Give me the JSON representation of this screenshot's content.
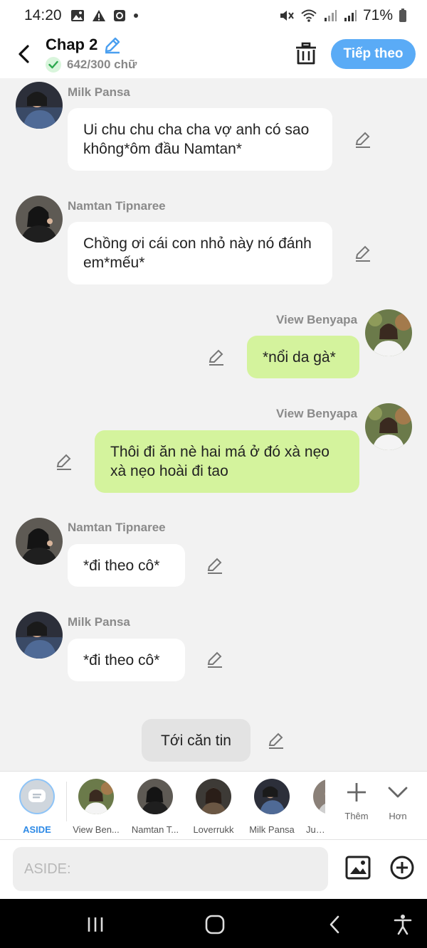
{
  "status_bar": {
    "time": "14:20",
    "battery": "71%"
  },
  "header": {
    "title": "Chap 2",
    "word_count": "642/300 chữ",
    "next_label": "Tiếp theo"
  },
  "messages": [
    {
      "sender": "Milk Pansa",
      "text": "Ui chu chu cha cha vợ anh có sao không*ôm đầu Namtan*",
      "side": "left"
    },
    {
      "sender": "Namtan Tipnaree",
      "text": "Chồng ơi cái con nhỏ này nó đánh em*mếu*",
      "side": "left"
    },
    {
      "sender": "View Benyapa",
      "text": "*nổi da gà*",
      "side": "right"
    },
    {
      "sender": "View Benyapa",
      "text": "Thôi đi ăn nè hai má ở đó xà nẹo xà nẹo hoài đi tao",
      "side": "right"
    },
    {
      "sender": "Namtan Tipnaree",
      "text": "*đi theo cô*",
      "side": "left"
    },
    {
      "sender": "Milk Pansa",
      "text": "*đi theo cô*",
      "side": "left"
    },
    {
      "sender": "",
      "text": "Tới căn tin",
      "side": "center"
    }
  ],
  "characters": [
    {
      "name": "ASIDE"
    },
    {
      "name": "View Ben..."
    },
    {
      "name": "Namtan T..."
    },
    {
      "name": "Loverrukk"
    },
    {
      "name": "Milk Pansa"
    },
    {
      "name": "June"
    }
  ],
  "tools": {
    "add_label": "Thêm",
    "more_label": "Hơn"
  },
  "input": {
    "placeholder": "ASIDE:"
  },
  "colors": {
    "accent": "#5aabf6",
    "right_bubble": "#d4f39d",
    "left_bubble": "#ffffff",
    "narration_bubble": "#e3e3e3"
  }
}
